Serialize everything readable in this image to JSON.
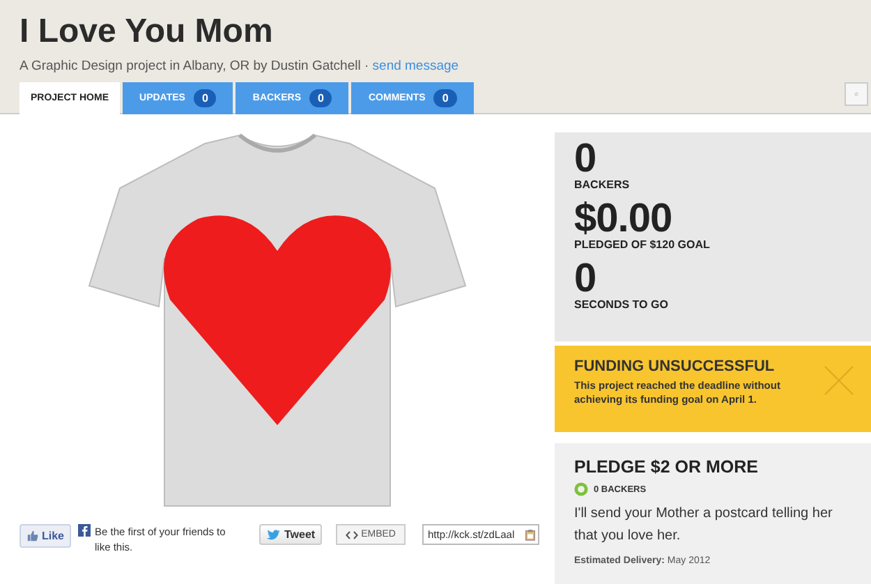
{
  "project": {
    "title": "I Love You Mom",
    "byline": "A Graphic Design project in Albany, OR by Dustin Gatchell · ",
    "link": "send message"
  },
  "tabs": [
    {
      "label": "PROJECT HOME",
      "selected": true
    },
    {
      "label": "UPDATES",
      "count": "0",
      "selected": false
    },
    {
      "label": "BACKERS",
      "count": "0",
      "selected": false
    },
    {
      "label": "COMMENTS",
      "count": "0",
      "selected": false
    }
  ],
  "share": {
    "like": "Like",
    "like_text": "Be the first of your friends to like this.",
    "tweet": "Tweet",
    "embed": "EMBED",
    "short_url": "http://kck.st/zdLaal"
  },
  "stats": [
    {
      "value": "0",
      "label": "BACKERS"
    },
    {
      "value": "$0.00",
      "label": "PLEDGED OF $120 GOAL"
    },
    {
      "value": "0",
      "label": "SECONDS TO GO"
    }
  ],
  "notice": {
    "title": "FUNDING UNSUCCESSFUL",
    "text": "This project reached the deadline without achieving its funding goal on April 1."
  },
  "reward": {
    "title": "PLEDGE $2 OR MORE",
    "backers": "0 BACKERS",
    "description": "I'll send your Mother a postcard telling her that you love her.",
    "delivery_label": "Estimated Delivery:",
    "delivery": "May 2012"
  }
}
